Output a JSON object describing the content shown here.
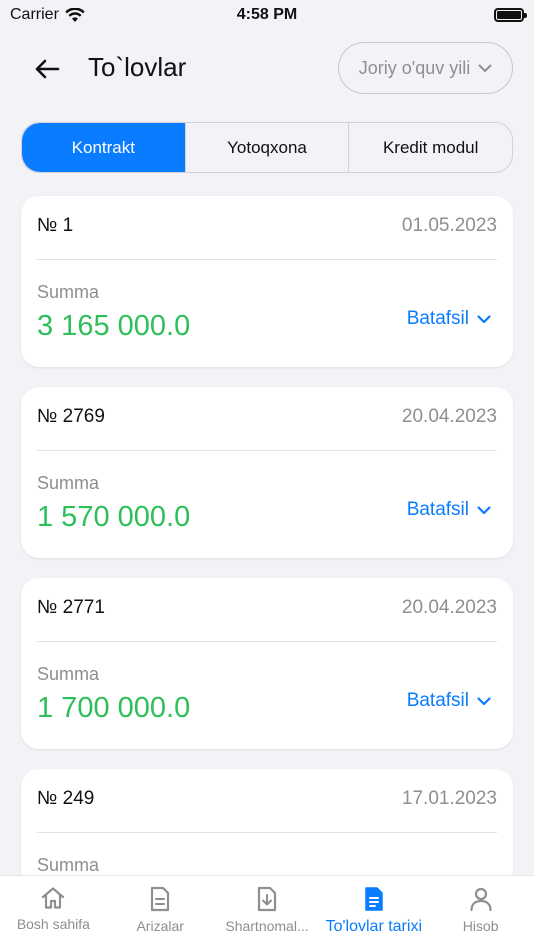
{
  "status_bar": {
    "carrier": "Carrier",
    "time": "4:58 PM"
  },
  "header": {
    "title": "To`lovlar",
    "year_select": "Joriy o'quv yili"
  },
  "tabs": [
    {
      "label": "Kontrakt",
      "active": true
    },
    {
      "label": "Yotoqxona",
      "active": false
    },
    {
      "label": "Kredit modul",
      "active": false
    }
  ],
  "payments": [
    {
      "number": "№ 1",
      "date": "01.05.2023",
      "label": "Summa",
      "amount": "3 165 000.0",
      "details": "Batafsil"
    },
    {
      "number": "№ 2769",
      "date": "20.04.2023",
      "label": "Summa",
      "amount": "1 570 000.0",
      "details": "Batafsil"
    },
    {
      "number": "№ 2771",
      "date": "20.04.2023",
      "label": "Summa",
      "amount": "1 700 000.0",
      "details": "Batafsil"
    },
    {
      "number": "№ 249",
      "date": "17.01.2023",
      "label": "Summa",
      "amount": "",
      "details": ""
    }
  ],
  "bottom_nav": [
    {
      "label": "Bosh sahifa",
      "icon": "home-icon"
    },
    {
      "label": "Arizalar",
      "icon": "document-icon"
    },
    {
      "label": "Shartnomal...",
      "icon": "download-document-icon"
    },
    {
      "label": "To'lovlar tarixi",
      "icon": "filled-document-icon",
      "active": true
    },
    {
      "label": "Hisob",
      "icon": "person-icon"
    }
  ],
  "colors": {
    "accent": "#0a7cff",
    "amount": "#2fbf5a",
    "muted": "#8e8e93",
    "background": "#f2f2f7"
  }
}
